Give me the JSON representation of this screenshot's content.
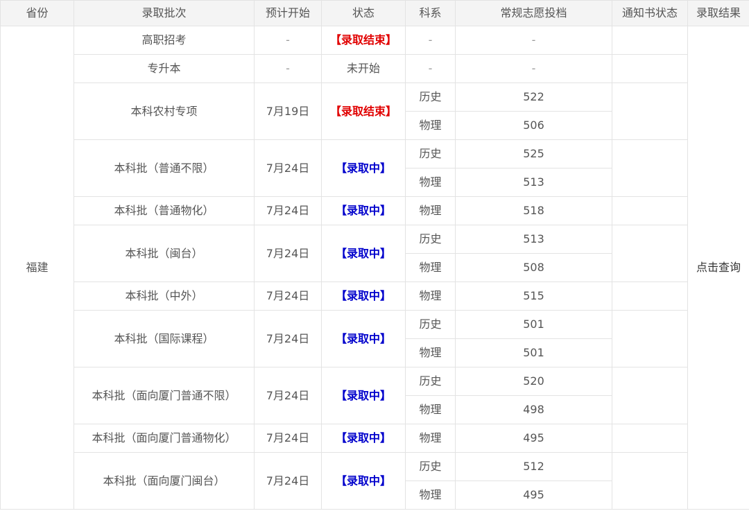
{
  "headers": {
    "province": "省份",
    "batch": "录取批次",
    "start": "预计开始",
    "status": "状态",
    "subject": "科系",
    "score": "常规志愿投档",
    "notice": "通知书状态",
    "result": "录取结果"
  },
  "province": "福建",
  "result_link": "点击查询",
  "colors": {
    "status_done": "#e10000",
    "status_going": "#0000cc",
    "header_bg": "#f4f4f4",
    "border": "#e3e3e3"
  },
  "rows": [
    {
      "batch": "高职招考",
      "start": "-",
      "status": "【录取结束】",
      "status_type": "done",
      "subjects": [
        {
          "name": "-",
          "score": "-"
        }
      ]
    },
    {
      "batch": "专升本",
      "start": "-",
      "status": "未开始",
      "status_type": "plain",
      "subjects": [
        {
          "name": "-",
          "score": "-"
        }
      ]
    },
    {
      "batch": "本科农村专项",
      "start": "7月19日",
      "status": "【录取结束】",
      "status_type": "done",
      "subjects": [
        {
          "name": "历史",
          "score": "522"
        },
        {
          "name": "物理",
          "score": "506"
        }
      ]
    },
    {
      "batch": "本科批（普通不限）",
      "start": "7月24日",
      "status": "【录取中】",
      "status_type": "going",
      "subjects": [
        {
          "name": "历史",
          "score": "525"
        },
        {
          "name": "物理",
          "score": "513"
        }
      ]
    },
    {
      "batch": "本科批（普通物化）",
      "start": "7月24日",
      "status": "【录取中】",
      "status_type": "going",
      "subjects": [
        {
          "name": "物理",
          "score": "518"
        }
      ]
    },
    {
      "batch": "本科批（闽台）",
      "start": "7月24日",
      "status": "【录取中】",
      "status_type": "going",
      "subjects": [
        {
          "name": "历史",
          "score": "513"
        },
        {
          "name": "物理",
          "score": "508"
        }
      ]
    },
    {
      "batch": "本科批（中外）",
      "start": "7月24日",
      "status": "【录取中】",
      "status_type": "going",
      "subjects": [
        {
          "name": "物理",
          "score": "515"
        }
      ]
    },
    {
      "batch": "本科批（国际课程）",
      "start": "7月24日",
      "status": "【录取中】",
      "status_type": "going",
      "subjects": [
        {
          "name": "历史",
          "score": "501"
        },
        {
          "name": "物理",
          "score": "501"
        }
      ]
    },
    {
      "batch": "本科批（面向厦门普通不限）",
      "start": "7月24日",
      "status": "【录取中】",
      "status_type": "going",
      "subjects": [
        {
          "name": "历史",
          "score": "520"
        },
        {
          "name": "物理",
          "score": "498"
        }
      ]
    },
    {
      "batch": "本科批（面向厦门普通物化）",
      "start": "7月24日",
      "status": "【录取中】",
      "status_type": "going",
      "subjects": [
        {
          "name": "物理",
          "score": "495"
        }
      ]
    },
    {
      "batch": "本科批（面向厦门闽台）",
      "start": "7月24日",
      "status": "【录取中】",
      "status_type": "going",
      "subjects": [
        {
          "name": "历史",
          "score": "512"
        },
        {
          "name": "物理",
          "score": "495"
        }
      ]
    }
  ]
}
